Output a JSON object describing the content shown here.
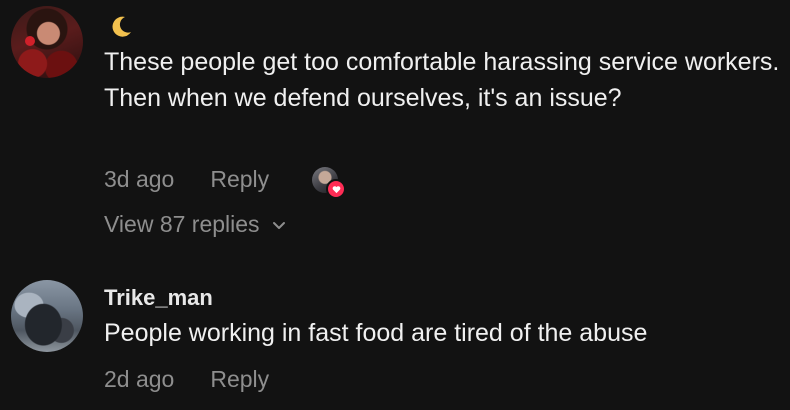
{
  "comments": [
    {
      "username_emoji": "🌙",
      "text": "These people get too comfortable harassing service workers. Then when we defend ourselves, it's an issue?",
      "time": "3d ago",
      "reply_label": "Reply",
      "creator_liked": true,
      "view_replies_label": "View 87 replies"
    },
    {
      "username": "Trike_man",
      "text": "People working in fast food are tired of the abuse",
      "time": "2d ago",
      "reply_label": "Reply"
    }
  ],
  "colors": {
    "background": "#121212",
    "primary_text": "#f0f0f0",
    "secondary_text": "#8e8e8e",
    "like_accent": "#fe2c55",
    "moon": "#f2c14e"
  },
  "icons": {
    "moon": "crescent-moon-icon",
    "heart": "heart-icon",
    "chevron": "chevron-down-icon"
  }
}
